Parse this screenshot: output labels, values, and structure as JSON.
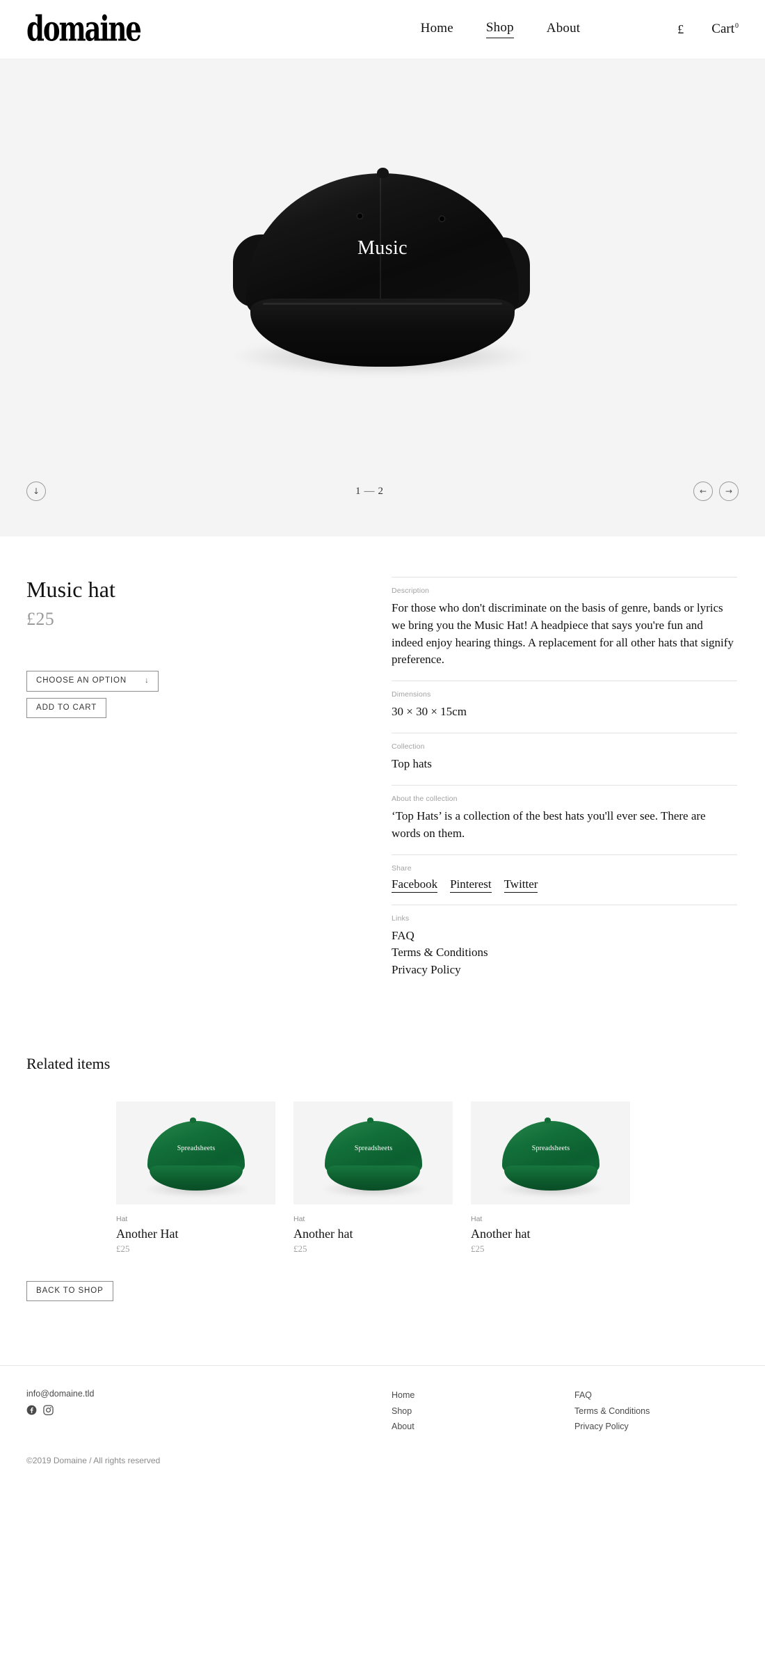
{
  "header": {
    "logo": "domaine",
    "nav": [
      {
        "label": "Home",
        "active": false
      },
      {
        "label": "Shop",
        "active": true
      },
      {
        "label": "About",
        "active": false
      }
    ],
    "currency": "£",
    "cart_label": "Cart",
    "cart_count": "0"
  },
  "hero": {
    "product_image_label": "Music",
    "scroll_icon": "↓",
    "pager_current": "1",
    "pager_dash": "—",
    "pager_total": "2",
    "prev_icon": "←",
    "next_icon": "→",
    "background": "#f4f4f4"
  },
  "product": {
    "title": "Music hat",
    "price": "£25",
    "choose_option_label": "CHOOSE AN OPTION",
    "choose_option_icon": "↓",
    "add_to_cart_label": "ADD TO CART",
    "specs": [
      {
        "label": "Description",
        "value": "For those who don't discriminate on the basis of genre, bands or lyrics we bring you the Music Hat! A headpiece that says you're fun and indeed enjoy hearing things. A replacement for all other hats that signify preference."
      },
      {
        "label": "Dimensions",
        "value": "30 × 30 × 15cm"
      },
      {
        "label": "Collection",
        "value": "Top hats"
      },
      {
        "label": "About the collection",
        "value": "‘Top Hats’ is a collection of the best hats you'll ever see. There are words on them."
      }
    ],
    "share": {
      "label": "Share",
      "items": [
        "Facebook",
        "Pinterest",
        "Twitter"
      ]
    },
    "links": {
      "label": "Links",
      "items": [
        "FAQ",
        "Terms & Conditions",
        "Privacy Policy"
      ]
    }
  },
  "related": {
    "title": "Related items",
    "items": [
      {
        "category": "Hat",
        "name": "Another Hat",
        "price": "£25",
        "image_label": "Spreadsheets",
        "color": "#136c36"
      },
      {
        "category": "Hat",
        "name": "Another hat",
        "price": "£25",
        "image_label": "Spreadsheets",
        "color": "#136c36"
      },
      {
        "category": "Hat",
        "name": "Another hat",
        "price": "£25",
        "image_label": "Spreadsheets",
        "color": "#136c36"
      }
    ],
    "back_label": "BACK TO SHOP"
  },
  "footer": {
    "email": "info@domaine.tld",
    "social": [
      "facebook-icon",
      "instagram-icon"
    ],
    "column_1": [
      "Home",
      "Shop",
      "About"
    ],
    "column_2": [
      "FAQ",
      "Terms & Conditions",
      "Privacy Policy"
    ],
    "copyright": "©2019 Domaine / All rights reserved"
  }
}
